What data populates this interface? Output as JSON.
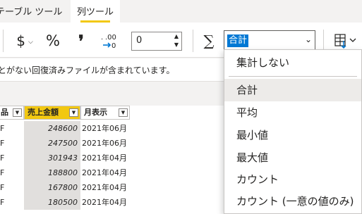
{
  "tabs": {
    "table_tools": "テーブル ツール",
    "column_tools": "列ツール"
  },
  "ribbon": {
    "currency_symbol": "$",
    "percent_symbol": "%",
    "comma_symbol": "❜",
    "decimal_label": ".00",
    "decimal_places_value": "0",
    "sigma_symbol": "∑",
    "summarization_selected": "合計"
  },
  "notice": {
    "text": "とがない回復済みファイルが含まれています。"
  },
  "grid": {
    "headers": [
      "品",
      "売上金額",
      "月表示"
    ],
    "rows": [
      {
        "c1": "F",
        "amount": "248600",
        "month": "2021年06月"
      },
      {
        "c1": "F",
        "amount": "247500",
        "month": "2021年06月"
      },
      {
        "c1": "F",
        "amount": "301943",
        "month": "2021年04月"
      },
      {
        "c1": "F",
        "amount": "188800",
        "month": "2021年04月"
      },
      {
        "c1": "F",
        "amount": "167800",
        "month": "2021年04月"
      },
      {
        "c1": "F",
        "amount": "180500",
        "month": "2021年04月"
      }
    ]
  },
  "summarization_menu": {
    "items": [
      "集計しない",
      "合計",
      "平均",
      "最小値",
      "最大値",
      "カウント",
      "カウント (一意の値のみ)"
    ],
    "selected_index": 1
  },
  "colors": {
    "accent_yellow": "#f2c811",
    "selection_blue": "#0078d4"
  }
}
